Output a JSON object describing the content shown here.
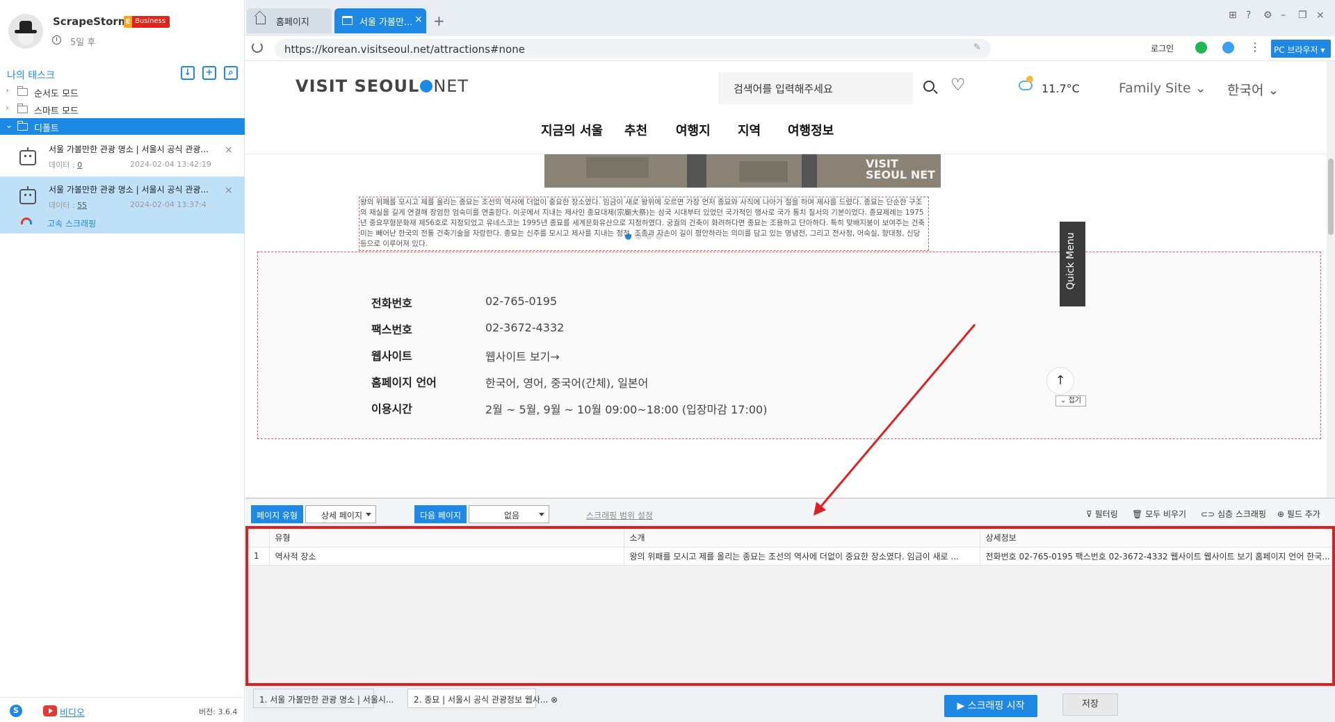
{
  "app": {
    "name": "ScrapeStorm",
    "badge_letter": "E",
    "badge": "Business",
    "days_left": "5일 후",
    "version": "버전: 3.6.4",
    "video_link": "비디오"
  },
  "sidebar": {
    "tasks_title": "나의 태스크",
    "tree": [
      {
        "label": "순서도 모드"
      },
      {
        "label": "스마트 모드"
      },
      {
        "label": "디폴트"
      }
    ],
    "tasks": [
      {
        "title": "서울 가볼만한 관광 명소 | 서울시 공식 관광...",
        "data_label": "데이터 :",
        "data_count": "0",
        "date": "2024-02-04 13:42:19"
      },
      {
        "title": "서울 가볼만한 관광 명소 | 서울시 공식 관광...",
        "data_label": "데이터 :",
        "data_count": "55",
        "date": "2024-02-04 13:37:4",
        "extra": "고속 스크래핑"
      }
    ]
  },
  "browser": {
    "tabs": [
      {
        "label": "홈페이지"
      },
      {
        "label": "서울 가볼만..."
      }
    ],
    "url": "https://korean.visitseoul.net/attractions#none",
    "login": "로그인",
    "pc_browser": "PC 브라우저 ▾"
  },
  "site": {
    "logo_left": "VISIT SEOUL",
    "logo_right": "NET",
    "search_placeholder": "검색어를 입력해주세요",
    "temperature": "11.7°C",
    "family_site": "Family Site ⌄",
    "language": "한국어 ⌄",
    "nav": [
      "지금의 서울",
      "추천",
      "여행지",
      "지역",
      "여행정보"
    ],
    "banner_logo": "VISIT SEOUL NET",
    "intro": "왕의 위패를 모시고 제를 올리는 종묘는 조선의 역사에 더없이 중요한 장소였다. 임금이 새로 왕위에 오르면 가장 먼저 종묘와 사직에 나아가 절을 하며 제사를 드렸다. 종묘는 단순한 구조의 재실을 길게 연결해 장엄한 엄숙미를 연출한다. 이곳에서 지내는 제사인 종묘대제(宗廟大祭)는 삼국 시대부터 있었던 국가적인 행사로 국가 통치 질서의 기본이었다. 종묘제례는 1975년 중요무형문화재 제56호로 지정되었고 유네스코는 1995년 종묘를 세계문화유산으로 지정하였다. 궁궐의 건축이 화려하다면 종묘는 조용하고 단아하다. 특히 맞배지붕이 보여주는 건축미는 빼어난 한국의 전통 건축기술을 자랑한다. 종묘는 신주를 모시고 제사를 지내는 정전, 조종과 자손이 길이 평안하라는 의미를 담고 있는 영녕전, 그리고 전사청, 어숙실, 향대청, 신당 등으로 이루어져 있다.",
    "details": [
      {
        "label": "전화번호",
        "value": "02-765-0195"
      },
      {
        "label": "팩스번호",
        "value": "02-3672-4332"
      },
      {
        "label": "웹사이트",
        "value": "웹사이트 보기→"
      },
      {
        "label": "홈페이지 언어",
        "value": "한국어, 영어, 중국어(간체), 일본어"
      },
      {
        "label": "이용시간",
        "value": "2월 ~ 5월, 9월 ~ 10월 09:00~18:00 (입장마감 17:00)"
      }
    ],
    "quick_menu": "Quick Menu",
    "collapse": "접기"
  },
  "panel": {
    "page_type_label": "페이지 유형",
    "page_type_value": "상세 페이지",
    "next_page_label": "다음 페이지",
    "next_page_value": "없음",
    "scrape_range": "스크래핑 범위 설정",
    "actions": [
      "필터링",
      "모두 비우기",
      "심층 스크래핑",
      "필드 추가"
    ],
    "columns": [
      "유형",
      "소개",
      "상세정보"
    ],
    "rows": [
      {
        "num": "1",
        "cells": [
          "역사적 장소",
          "왕의 위패를 모시고 제를 올리는 종묘는 조선의 역사에 더없이 중요한 장소였다. 임금이 새로 ...",
          "전화번호 02-765-0195 팩스번호 02-3672-4332 웹사이트 웹사이트 보기 홈페이지 언어 한국..."
        ]
      }
    ]
  },
  "bottom": {
    "tabs": [
      "1. 서울 가볼만한 관광 명소 | 서울시...",
      "2. 종묘 | 서울시 공식 관광정보 웹사..."
    ],
    "start": "▶ 스크래핑 시작",
    "save": "저장"
  },
  "colors": {
    "accent": "#1e88e5",
    "highlight": "#e02020",
    "badge": "#e1251b"
  }
}
